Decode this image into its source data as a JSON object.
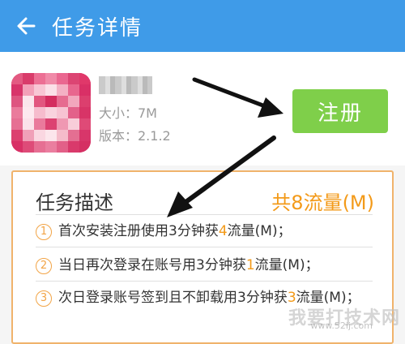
{
  "header": {
    "title": "任务详情",
    "back_icon": "arrow-left-icon"
  },
  "app": {
    "name": "",
    "size": "大小：7M",
    "version": "版本：2.1.2",
    "icon": "app-icon-pixelated"
  },
  "actions": {
    "register_label": "注册"
  },
  "task": {
    "title": "任务描述",
    "total": "共8流量(M)",
    "items": [
      {
        "num": "1",
        "text_before": "首次安装注册使用3分钟获",
        "highlight": "4",
        "text_after": "流量(M)；"
      },
      {
        "num": "2",
        "text_before": "当日再次登录在账号用3分钟获",
        "highlight": "1",
        "text_after": "流量(M)；"
      },
      {
        "num": "3",
        "text_before": "次日登录账号签到且不卸载用3分钟获",
        "highlight": "3",
        "text_after": "流量(M)；"
      }
    ]
  },
  "watermark": {
    "text": "我要打技术网",
    "url": "www.52ij.com"
  },
  "colors": {
    "header": "#3f9be8",
    "register": "#7fcf4a",
    "accent": "#f39a19",
    "border": "#f0b36b"
  }
}
